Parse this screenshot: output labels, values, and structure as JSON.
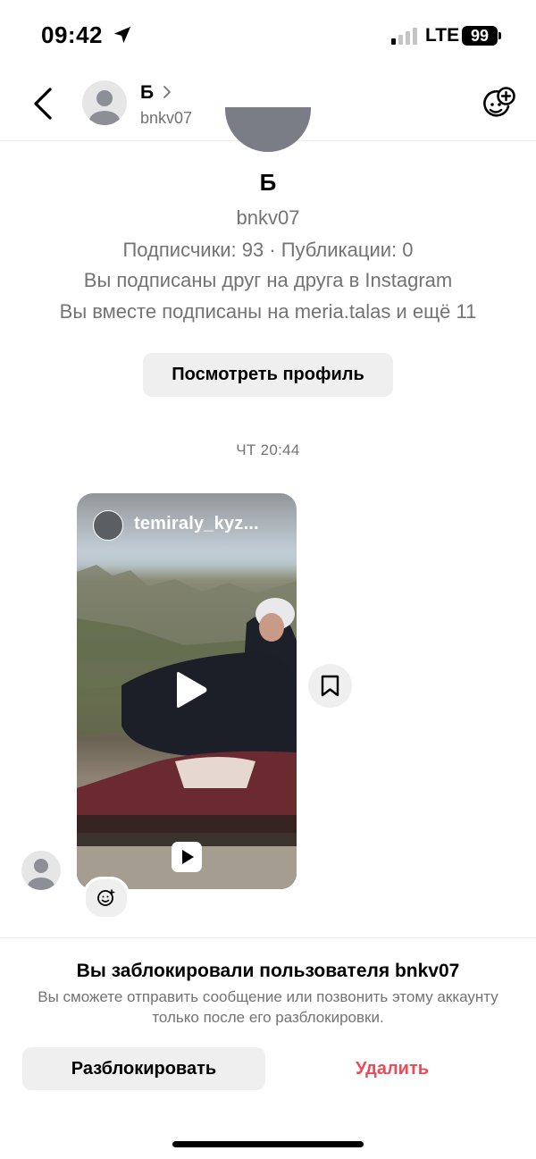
{
  "status_bar": {
    "time": "09:42",
    "network": "LTE",
    "battery": "99",
    "location_icon": "location-arrow-icon",
    "signal_icon": "signal-bars-icon"
  },
  "header": {
    "name": "Б",
    "username": "bnkv07",
    "back_icon": "chevron-left-icon",
    "sticker_icon": "add-sticker-icon"
  },
  "profile_card": {
    "name": "Б",
    "username": "bnkv07",
    "stats": "Подписчики: 93 · Публикации: 0",
    "mutual_follow": "Вы подписаны друг на друга в Instagram",
    "common_follow": "Вы вместе подписаны на meria.talas и ещё 11",
    "view_profile_label": "Посмотреть профиль"
  },
  "conversation": {
    "timestamp": "ЧТ 20:44",
    "reel": {
      "author": "temiraly_kyz...",
      "type_icon": "reel-play-icon"
    }
  },
  "blocked_notice": {
    "title": "Вы заблокировали пользователя bnkv07",
    "subtitle": "Вы сможете отправить сообщение или позвонить этому аккаунту только после его разблокировки.",
    "unblock_label": "Разблокировать",
    "delete_label": "Удалить"
  },
  "colors": {
    "accent_red": "#ed4956",
    "secondary_text": "#737373",
    "button_bg": "#efefef"
  }
}
